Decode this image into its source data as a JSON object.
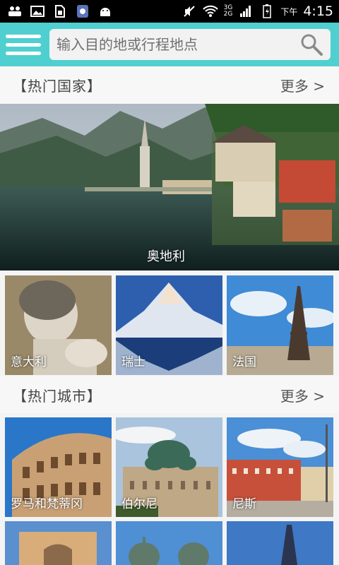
{
  "status_bar": {
    "time": "4:15",
    "ampm": "下午",
    "net_top": "3G",
    "net_bottom": "2G",
    "icons": [
      "people-icon",
      "image-icon",
      "sim-card-icon",
      "app-icon",
      "android-icon",
      "mute-icon",
      "wifi-icon",
      "signal-icon",
      "battery-icon"
    ]
  },
  "header": {
    "search_placeholder": "输入目的地或行程地点"
  },
  "countries_section": {
    "title": "【热门国家】",
    "more": "更多 >",
    "featured": {
      "name": "奥地利"
    },
    "items": [
      {
        "name": "意大利"
      },
      {
        "name": "瑞士"
      },
      {
        "name": "法国"
      }
    ]
  },
  "cities_section": {
    "title": "【热门城市】",
    "more": "更多 >",
    "items": [
      {
        "name": "罗马和梵蒂冈"
      },
      {
        "name": "伯尔尼"
      },
      {
        "name": "尼斯"
      }
    ]
  },
  "colors": {
    "accent": "#4fcfd0",
    "background": "#f4f4f4"
  }
}
